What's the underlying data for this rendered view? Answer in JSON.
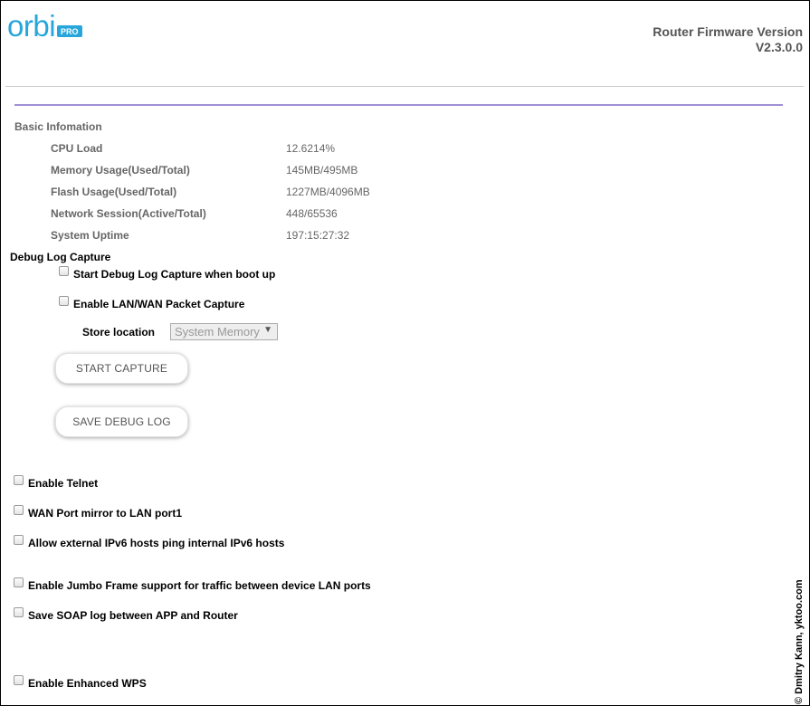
{
  "header": {
    "logo_text": "orbi",
    "logo_badge": "PRO",
    "firmware_label": "Router Firmware Version",
    "firmware_version": "V2.3.0.0"
  },
  "basic_info": {
    "title": "Basic Infomation",
    "rows": [
      {
        "label": "CPU Load",
        "value": "12.6214%"
      },
      {
        "label": "Memory Usage(Used/Total)",
        "value": "145MB/495MB"
      },
      {
        "label": "Flash Usage(Used/Total)",
        "value": "1227MB/4096MB"
      },
      {
        "label": "Network Session(Active/Total)",
        "value": "448/65536"
      },
      {
        "label": "System Uptime",
        "value": "197:15:27:32"
      }
    ]
  },
  "debug": {
    "title": "Debug Log Capture",
    "start_on_boot_label": "Start Debug Log Capture when boot up",
    "packet_capture_label": "Enable LAN/WAN Packet Capture",
    "store_location_label": "Store location",
    "store_location_value": "System Memory",
    "start_capture_button": "START CAPTURE",
    "save_log_button": "SAVE DEBUG LOG"
  },
  "options": {
    "telnet": "Enable Telnet",
    "port_mirror": "WAN Port mirror to LAN port1",
    "ipv6_ping": "Allow external IPv6 hosts ping internal IPv6 hosts",
    "jumbo_frame": "Enable Jumbo Frame support for traffic between device LAN ports",
    "soap_log": "Save SOAP log between APP and Router",
    "enhanced_wps": "Enable Enhanced WPS"
  },
  "credit": "© Dmitry Kann, yktoo.com"
}
